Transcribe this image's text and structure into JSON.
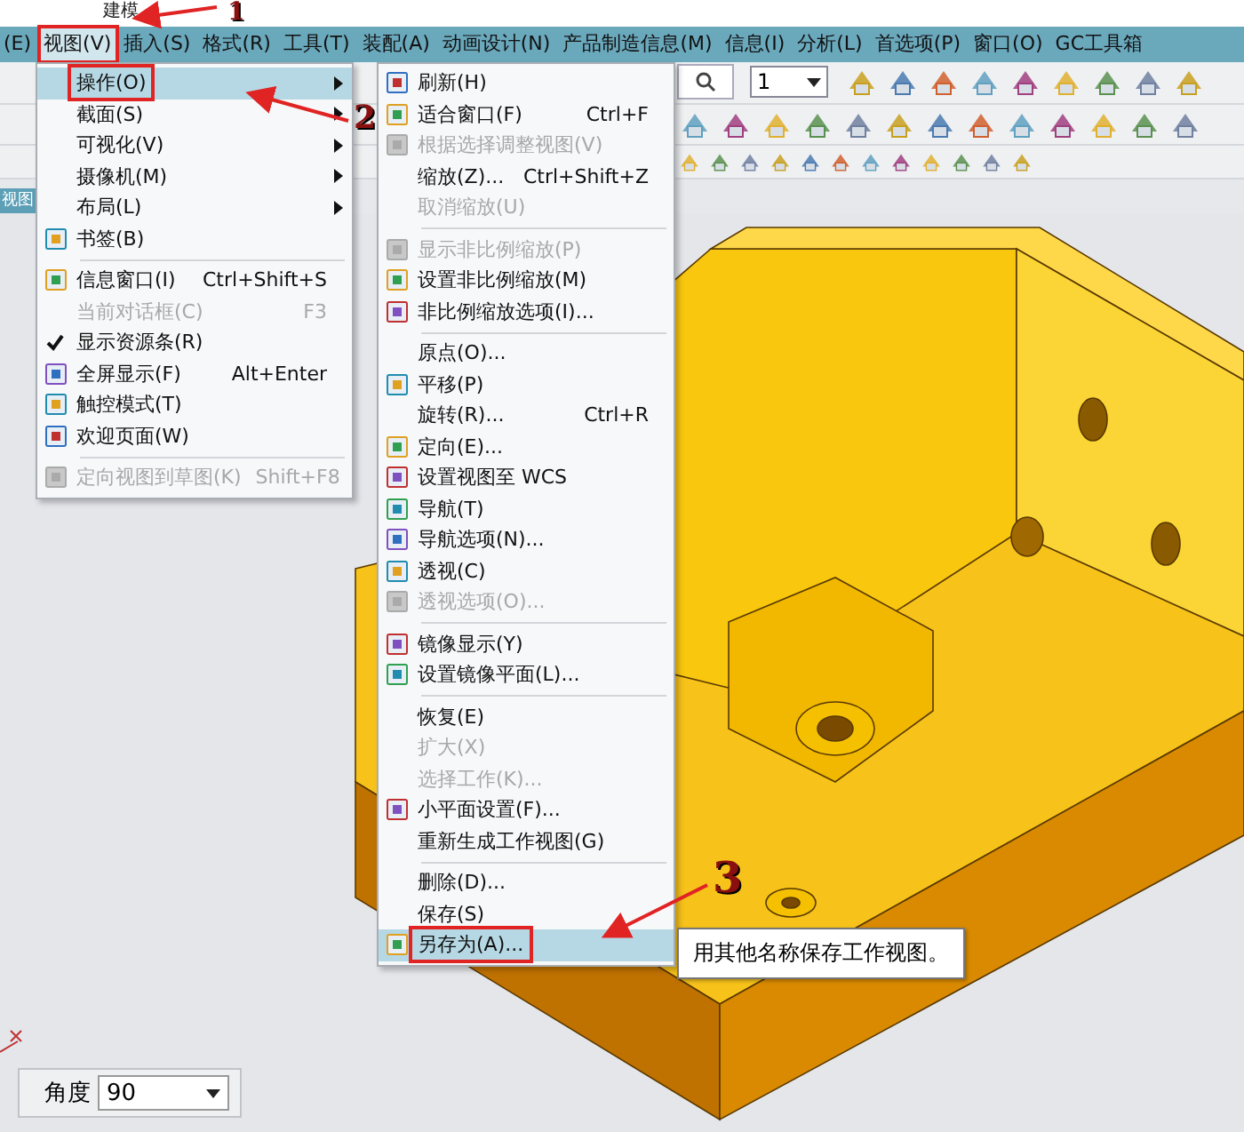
{
  "title_bar": {
    "title": "建模"
  },
  "menu_bar": {
    "items": [
      {
        "label": "(E)",
        "selected": false
      },
      {
        "label": "视图(V)",
        "selected": true
      },
      {
        "label": "插入(S)",
        "selected": false
      },
      {
        "label": "格式(R)",
        "selected": false
      },
      {
        "label": "工具(T)",
        "selected": false
      },
      {
        "label": "装配(A)",
        "selected": false
      },
      {
        "label": "动画设计(N)",
        "selected": false
      },
      {
        "label": "产品制造信息(M)",
        "selected": false
      },
      {
        "label": "信息(I)",
        "selected": false
      },
      {
        "label": "分析(L)",
        "selected": false
      },
      {
        "label": "首选项(P)",
        "selected": false
      },
      {
        "label": "窗口(O)",
        "selected": false
      },
      {
        "label": "GC工具箱",
        "selected": false
      }
    ]
  },
  "toolbar": {
    "layer_value": "1"
  },
  "view_tab": {
    "label": "视图"
  },
  "view_menu": {
    "items": [
      {
        "kind": "submenu",
        "label": "操作(O)",
        "icon": false,
        "disabled": false,
        "selected": true
      },
      {
        "kind": "submenu",
        "label": "截面(S)",
        "icon": false,
        "disabled": false,
        "selected": false
      },
      {
        "kind": "submenu",
        "label": "可视化(V)",
        "icon": false,
        "disabled": false,
        "selected": false
      },
      {
        "kind": "submenu",
        "label": "摄像机(M)",
        "icon": false,
        "disabled": false,
        "selected": false
      },
      {
        "kind": "submenu",
        "label": "布局(L)",
        "icon": false,
        "disabled": false,
        "selected": false
      },
      {
        "kind": "item",
        "label": "书签(B)",
        "icon": true,
        "disabled": false,
        "selected": false
      },
      {
        "kind": "separator"
      },
      {
        "kind": "item",
        "label": "信息窗口(I)",
        "shortcut": "Ctrl+Shift+S",
        "icon": true,
        "disabled": false,
        "selected": false
      },
      {
        "kind": "item",
        "label": "当前对话框(C)",
        "shortcut": "F3",
        "icon": false,
        "disabled": true,
        "selected": false
      },
      {
        "kind": "check",
        "label": "显示资源条(R)",
        "checked": true,
        "icon": false,
        "disabled": false,
        "selected": false
      },
      {
        "kind": "item",
        "label": "全屏显示(F)",
        "shortcut": "Alt+Enter",
        "icon": true,
        "disabled": false,
        "selected": false
      },
      {
        "kind": "item",
        "label": "触控模式(T)",
        "icon": true,
        "disabled": false,
        "selected": false
      },
      {
        "kind": "item",
        "label": "欢迎页面(W)",
        "icon": true,
        "disabled": false,
        "selected": false
      },
      {
        "kind": "separator"
      },
      {
        "kind": "item",
        "label": "定向视图到草图(K)",
        "shortcut": "Shift+F8",
        "icon": true,
        "disabled": true,
        "selected": false
      }
    ]
  },
  "operation_menu": {
    "items": [
      {
        "kind": "item",
        "label": "刷新(H)",
        "icon": true,
        "disabled": false,
        "selected": false
      },
      {
        "kind": "item",
        "label": "适合窗口(F)",
        "shortcut": "Ctrl+F",
        "icon": true,
        "disabled": false,
        "selected": false
      },
      {
        "kind": "item",
        "label": "根据选择调整视图(V)",
        "icon": true,
        "disabled": true,
        "selected": false
      },
      {
        "kind": "item",
        "label": "缩放(Z)...",
        "shortcut": "Ctrl+Shift+Z",
        "icon": false,
        "disabled": false,
        "selected": false
      },
      {
        "kind": "item",
        "label": "取消缩放(U)",
        "icon": false,
        "disabled": true,
        "selected": false
      },
      {
        "kind": "separator"
      },
      {
        "kind": "item",
        "label": "显示非比例缩放(P)",
        "icon": true,
        "disabled": true,
        "selected": false
      },
      {
        "kind": "item",
        "label": "设置非比例缩放(M)",
        "icon": true,
        "disabled": false,
        "selected": false
      },
      {
        "kind": "item",
        "label": "非比例缩放选项(I)...",
        "icon": true,
        "disabled": false,
        "selected": false
      },
      {
        "kind": "separator"
      },
      {
        "kind": "item",
        "label": "原点(O)...",
        "icon": false,
        "disabled": false,
        "selected": false
      },
      {
        "kind": "item",
        "label": "平移(P)",
        "icon": true,
        "disabled": false,
        "selected": false
      },
      {
        "kind": "item",
        "label": "旋转(R)...",
        "shortcut": "Ctrl+R",
        "icon": false,
        "disabled": false,
        "selected": false
      },
      {
        "kind": "item",
        "label": "定向(E)...",
        "icon": true,
        "disabled": false,
        "selected": false
      },
      {
        "kind": "item",
        "label": "设置视图至 WCS",
        "icon": true,
        "disabled": false,
        "selected": false
      },
      {
        "kind": "item",
        "label": "导航(T)",
        "icon": true,
        "disabled": false,
        "selected": false
      },
      {
        "kind": "item",
        "label": "导航选项(N)...",
        "icon": true,
        "disabled": false,
        "selected": false
      },
      {
        "kind": "item",
        "label": "透视(C)",
        "icon": true,
        "disabled": false,
        "selected": false
      },
      {
        "kind": "item",
        "label": "透视选项(O)...",
        "icon": true,
        "disabled": true,
        "selected": false
      },
      {
        "kind": "separator"
      },
      {
        "kind": "item",
        "label": "镜像显示(Y)",
        "icon": true,
        "disabled": false,
        "selected": false
      },
      {
        "kind": "item",
        "label": "设置镜像平面(L)...",
        "icon": true,
        "disabled": false,
        "selected": false
      },
      {
        "kind": "separator"
      },
      {
        "kind": "item",
        "label": "恢复(E)",
        "icon": false,
        "disabled": false,
        "selected": false
      },
      {
        "kind": "item",
        "label": "扩大(X)",
        "icon": false,
        "disabled": true,
        "selected": false
      },
      {
        "kind": "item",
        "label": "选择工作(K)...",
        "icon": false,
        "disabled": true,
        "selected": false
      },
      {
        "kind": "item",
        "label": "小平面设置(F)...",
        "icon": true,
        "disabled": false,
        "selected": false
      },
      {
        "kind": "item",
        "label": "重新生成工作视图(G)",
        "icon": false,
        "disabled": false,
        "selected": false
      },
      {
        "kind": "separator"
      },
      {
        "kind": "item",
        "label": "删除(D)...",
        "icon": false,
        "disabled": false,
        "selected": false
      },
      {
        "kind": "item",
        "label": "保存(S)",
        "icon": false,
        "disabled": false,
        "selected": false
      },
      {
        "kind": "item",
        "label": "另存为(A)...",
        "icon": true,
        "disabled": false,
        "selected": true
      }
    ]
  },
  "tooltip": {
    "text": "用其他名称保存工作视图。"
  },
  "annotations": [
    {
      "label": "1"
    },
    {
      "label": "2"
    },
    {
      "label": "3"
    }
  ],
  "angle_field": {
    "label": "角度",
    "value": "90"
  }
}
